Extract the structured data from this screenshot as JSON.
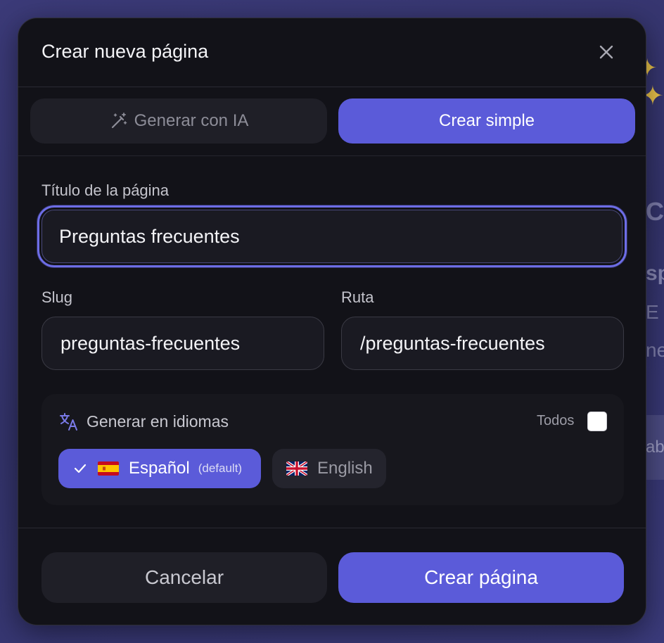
{
  "background": {
    "text_1": "C",
    "text_2": "sp",
    "text_3": "E",
    "text_4": "ne",
    "text_5": "ab"
  },
  "dialog": {
    "title": "Crear nueva página",
    "close_icon": "close-icon"
  },
  "mode_tabs": {
    "ai_label": "Generar con IA",
    "ai_icon": "magic-wand-icon",
    "simple_label": "Crear simple",
    "active": "simple"
  },
  "form": {
    "title_label": "Título de la página",
    "title_value": "Preguntas frecuentes",
    "slug_label": "Slug",
    "slug_value": "preguntas-frecuentes",
    "route_label": "Ruta",
    "route_value": "/preguntas-frecuentes"
  },
  "languages": {
    "icon": "translate-icon",
    "label": "Generar en idiomas",
    "all_label": "Todos",
    "all_checked": false,
    "items": [
      {
        "name": "Español",
        "note": "(default)",
        "flag": "spain-flag",
        "selected": true
      },
      {
        "name": "English",
        "note": "",
        "flag": "uk-flag",
        "selected": false
      }
    ]
  },
  "footer": {
    "cancel_label": "Cancelar",
    "create_label": "Crear página"
  },
  "colors": {
    "accent": "#5b5bd9",
    "modal_bg": "#121218",
    "backdrop": "#3b3a78"
  }
}
